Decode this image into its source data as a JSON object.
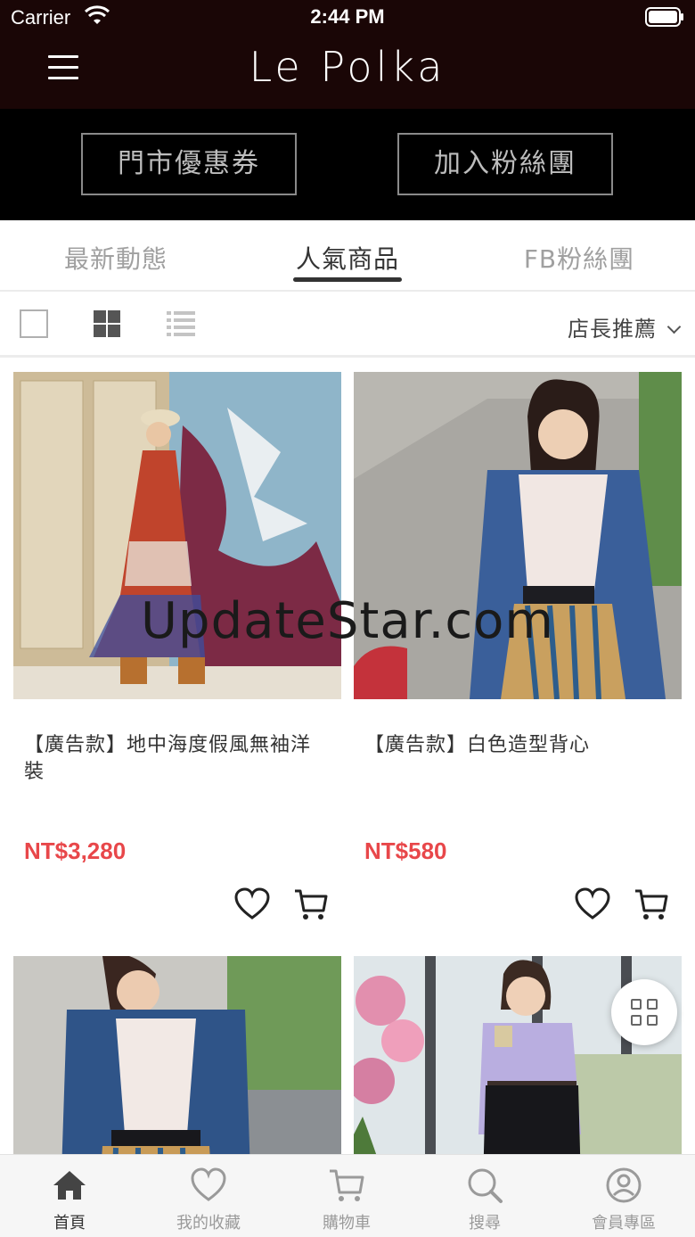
{
  "status_bar": {
    "carrier": "Carrier",
    "time": "2:44 PM"
  },
  "header": {
    "brand": "Le Polka",
    "menu_icon": "hamburger-menu-icon"
  },
  "promo": {
    "coupon_label": "門市優惠券",
    "fans_label": "加入粉絲團"
  },
  "tabs": [
    {
      "label": "最新動態",
      "active": false
    },
    {
      "label": "人氣商品",
      "active": true
    },
    {
      "label": "FB粉絲團",
      "active": false
    }
  ],
  "toolbar": {
    "sort_label": "店長推薦",
    "views": [
      "single-view-icon",
      "grid-view-icon",
      "list-view-icon"
    ]
  },
  "products": [
    {
      "name": "【廣告款】地中海度假風無袖洋裝",
      "price": "NT$3,280"
    },
    {
      "name": "【廣告款】白色造型背心",
      "price": "NT$580"
    },
    {
      "name": "",
      "price": ""
    },
    {
      "name": "",
      "price": ""
    }
  ],
  "watermark": "UpdateStar.com",
  "bottom_nav": [
    {
      "label": "首頁",
      "icon": "home-icon",
      "active": true
    },
    {
      "label": "我的收藏",
      "icon": "heart-icon",
      "active": false
    },
    {
      "label": "購物車",
      "icon": "cart-icon",
      "active": false
    },
    {
      "label": "搜尋",
      "icon": "search-icon",
      "active": false
    },
    {
      "label": "會員專區",
      "icon": "user-icon",
      "active": false
    }
  ],
  "colors": {
    "header_bg": "#1a0606",
    "price": "#e8474a",
    "tab_active": "#333333"
  }
}
